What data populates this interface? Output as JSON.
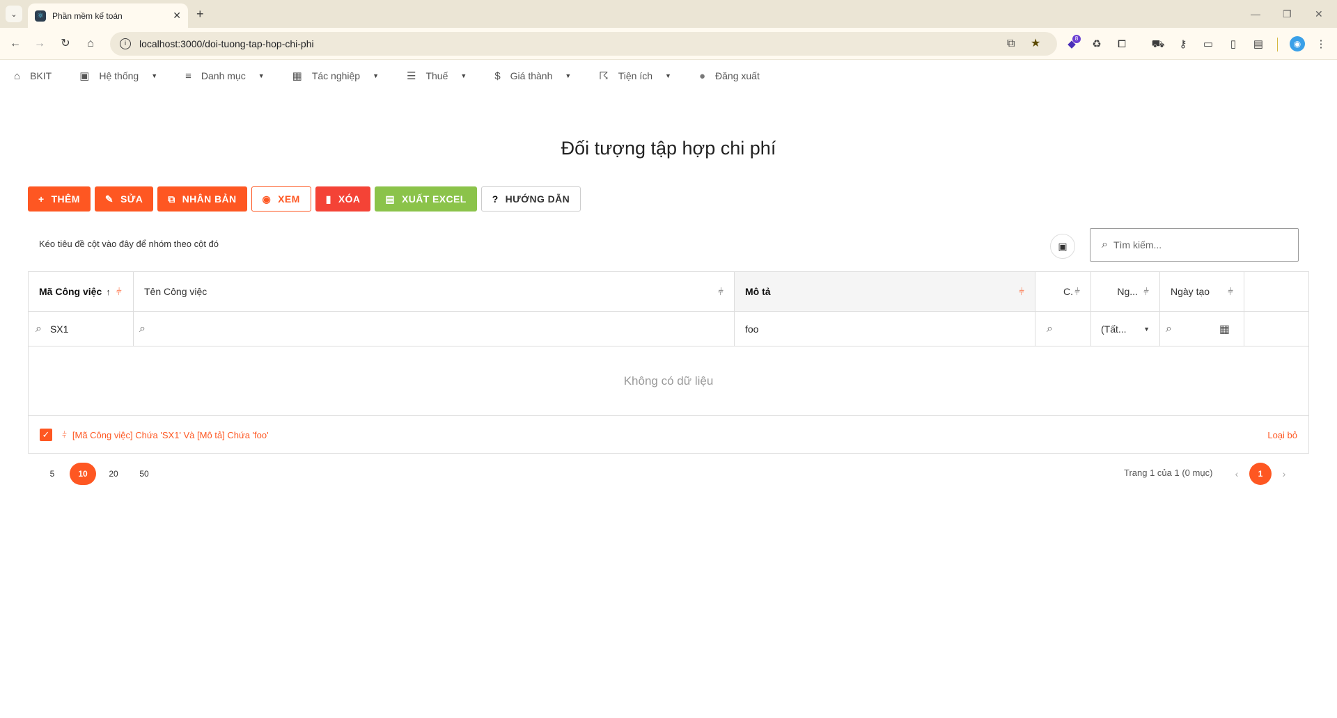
{
  "browser": {
    "tab_title": "Phần mềm kế toán",
    "url": "localhost:3000/doi-tuong-tap-hop-chi-phi",
    "ext_badge_count": "8"
  },
  "menu": [
    {
      "label": "BKIT",
      "icon": "home-icon",
      "glyph": "⌂",
      "has_caret": false
    },
    {
      "label": "Hệ thống",
      "icon": "save-icon",
      "glyph": "▣",
      "has_caret": true
    },
    {
      "label": "Danh mục",
      "icon": "list-icon",
      "glyph": "≡",
      "has_caret": true
    },
    {
      "label": "Tác nghiệp",
      "icon": "table-edit-icon",
      "glyph": "▦",
      "has_caret": true
    },
    {
      "label": "Thuế",
      "icon": "checklist-icon",
      "glyph": "☰",
      "has_caret": true
    },
    {
      "label": "Giá thành",
      "icon": "dollar-icon",
      "glyph": "$",
      "has_caret": true
    },
    {
      "label": "Tiện ích",
      "icon": "run-icon",
      "glyph": "☈",
      "has_caret": true
    },
    {
      "label": "Đăng xuất",
      "icon": "logout-icon",
      "glyph": "●",
      "has_caret": false
    }
  ],
  "page": {
    "title": "Đối tượng tập hợp chi phí"
  },
  "actions": {
    "add": "THÊM",
    "edit": "SỬA",
    "duplicate": "NHÂN BẢN",
    "view": "XEM",
    "delete": "XÓA",
    "export": "XUẤT EXCEL",
    "help": "HƯỚNG DẪN"
  },
  "grid": {
    "group_panel": "Kéo tiêu đề cột vào đây để nhóm theo cột đó",
    "search_placeholder": "Tìm kiếm...",
    "columns": {
      "code": "Mã Công việc",
      "name": "Tên Công việc",
      "desc": "Mô tả",
      "c": "C.",
      "ng": "Ng...",
      "created": "Ngày tạo"
    },
    "filters": {
      "code": "SX1",
      "desc": "foo",
      "ng": "(Tất..."
    },
    "no_data": "Không có dữ liệu",
    "filter_expression": "[Mã Công việc] Chứa 'SX1' Và [Mô tả] Chứa 'foo'",
    "clear_filter": "Loại bỏ"
  },
  "pager": {
    "sizes": [
      "5",
      "10",
      "20",
      "50"
    ],
    "active_size": "10",
    "info": "Trang 1 của 1 (0 mục)",
    "current_page": "1"
  },
  "colors": {
    "accent": "#fe5722",
    "danger": "#f44336",
    "success": "#8bc34a"
  }
}
